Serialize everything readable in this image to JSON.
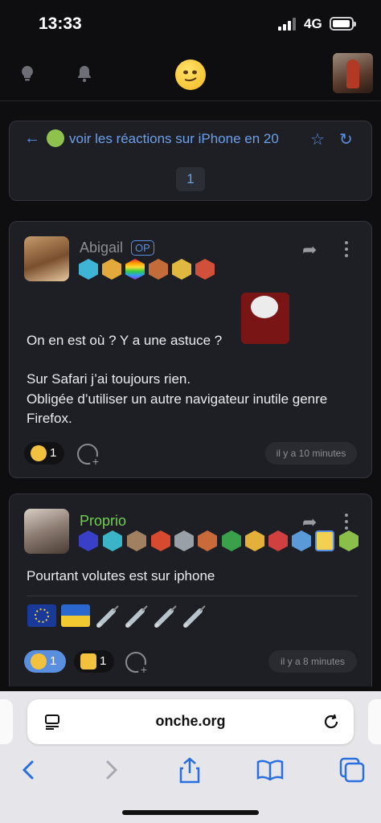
{
  "status_bar": {
    "time": "13:33",
    "network": "4G"
  },
  "topic": {
    "title": "voir les réactions sur iPhone en 20",
    "page": "1"
  },
  "posts": [
    {
      "author": "Abigail",
      "op_label": "OP",
      "author_color": "#8d8d95",
      "text_lines": [
        "On en est où ? Y a une astuce ?",
        "",
        "Sur Safari j’ai toujours rien.",
        "Obligée d’utiliser un autre navigateur inutile genre",
        "Firefox."
      ],
      "reactions": [
        {
          "emoji": "thinking-face",
          "count": "1"
        }
      ],
      "time": "il y a 10 minutes"
    },
    {
      "author": "Proprio",
      "author_color": "#6fcf52",
      "text": "Pourtant volutes est sur iphone",
      "reactions": [
        {
          "emoji": "relieved-face",
          "count": "1"
        },
        {
          "emoji": "thumbs-up",
          "count": "1"
        }
      ],
      "time": "il y a 8 minutes"
    }
  ],
  "browser": {
    "url": "onche.org"
  },
  "colors": {
    "accent": "#5a8fe0",
    "card": "#1e1f24",
    "background": "#0e0e10"
  }
}
